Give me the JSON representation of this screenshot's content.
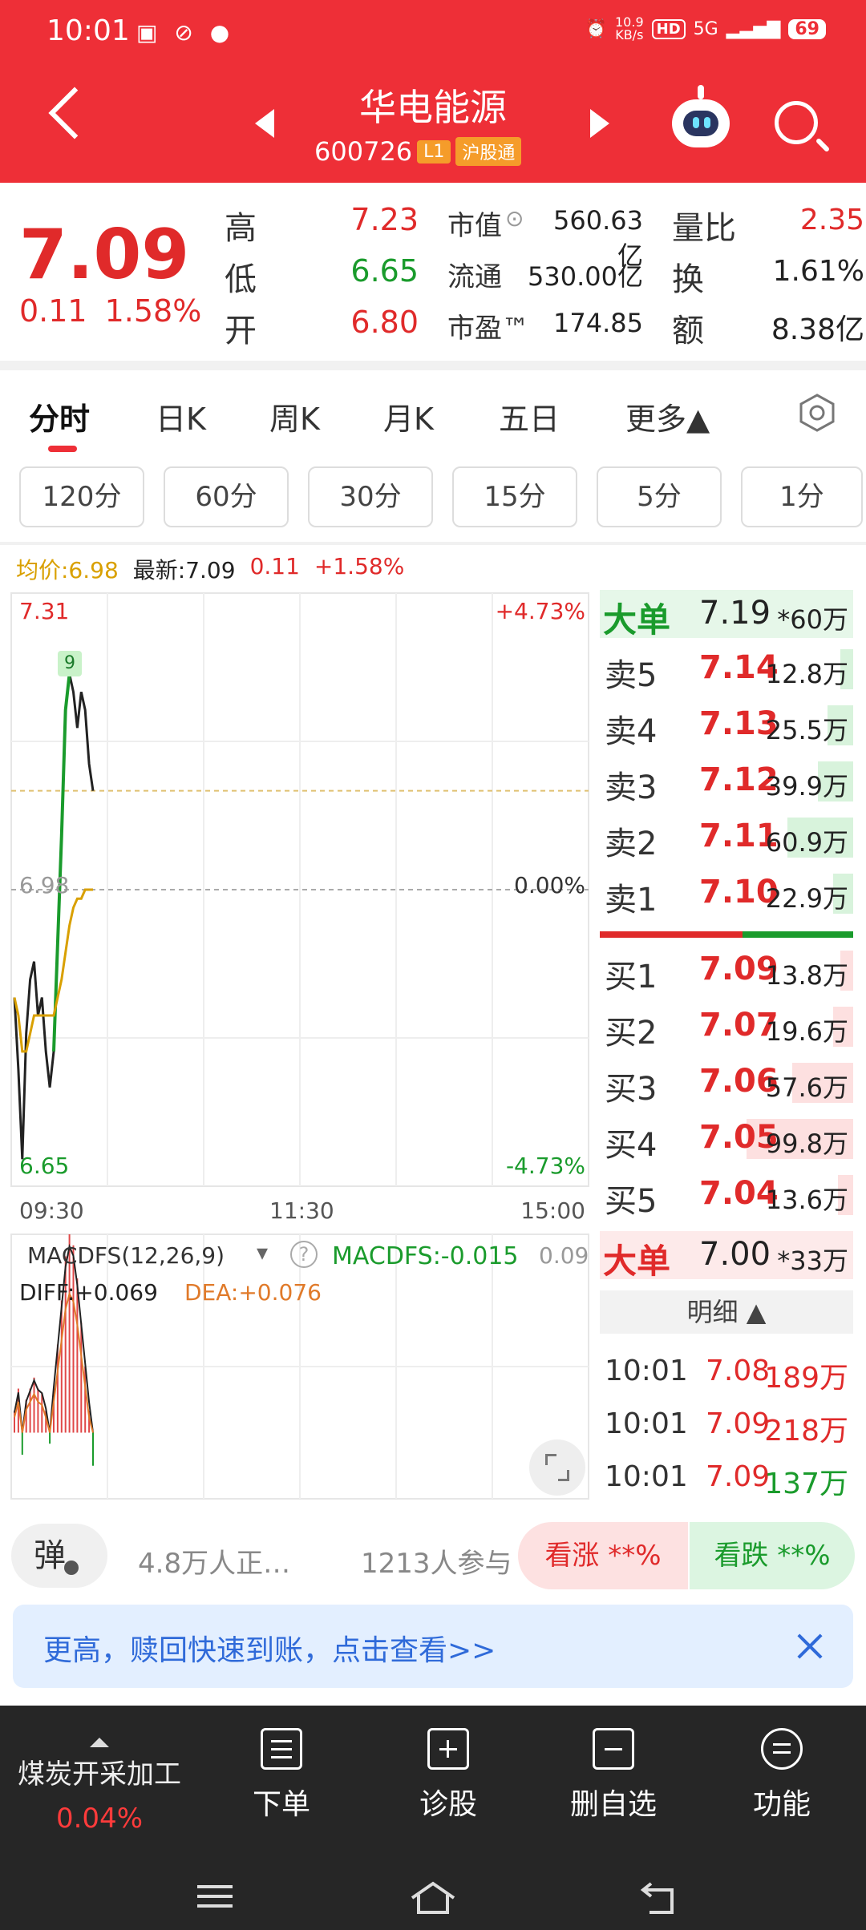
{
  "status_bar": {
    "time": "10:01",
    "notifications": "▣ ⊘ ●",
    "speed": "10.9",
    "speed_unit": "KB/s",
    "hd": "HD",
    "network": "5G",
    "battery": "69"
  },
  "header": {
    "stock_name": "华电能源",
    "stock_code": "600726",
    "tag_level": "L1",
    "tag_market": "沪股通"
  },
  "quote": {
    "price": "7.09",
    "change": "0.11",
    "change_pct": "1.58%",
    "high_label": "高",
    "high": "7.23",
    "low_label": "低",
    "low": "6.65",
    "open_label": "开",
    "open": "6.80",
    "mktcap_label": "市值",
    "mktcap": "560.63亿",
    "float_label": "流通",
    "float": "530.00亿",
    "pe_label": "市盈™",
    "pe": "174.85",
    "vol_ratio_label": "量比",
    "vol_ratio": "2.35",
    "turnover_label": "换",
    "turnover": "1.61%",
    "amount_label": "额",
    "amount": "8.38亿"
  },
  "tabs": [
    "分时",
    "日K",
    "周K",
    "月K",
    "五日",
    "更多▲"
  ],
  "intervals": [
    "120分",
    "60分",
    "30分",
    "15分",
    "5分",
    "1分"
  ],
  "info_line": {
    "avg": "均价:6.98",
    "latest": "最新:7.09",
    "chg": "0.11",
    "pct": "+1.58%"
  },
  "chart_labels": {
    "top_price": "7.31",
    "mid_price": "6.98",
    "low_price": "6.65",
    "top_pct": "+4.73%",
    "mid_pct": "0.00%",
    "low_pct": "-4.73%",
    "t_start": "09:30",
    "t_mid": "11:30",
    "t_end": "15:00",
    "high_marker": "9",
    "macd_title": "MACDFS(12,26,9)",
    "macd_value": "MACDFS:-0.015",
    "macd_axis": "0.09",
    "diff": "DIFF:+0.069",
    "dea": "DEA:+0.076"
  },
  "chart_data": {
    "type": "line",
    "title": "",
    "xlabel": "",
    "ylabel": "",
    "x_ticks": [
      "09:30",
      "11:30",
      "15:00"
    ],
    "ylim": [
      6.65,
      7.31
    ],
    "pre_close": 6.98,
    "series": [
      {
        "values": [
          6.86,
          6.78,
          6.68,
          6.82,
          6.88,
          6.9,
          6.84,
          6.86,
          6.8,
          6.76,
          6.8,
          6.92,
          7.04,
          7.18,
          7.22,
          7.2,
          7.16,
          7.2,
          7.18,
          7.12,
          7.09
        ]
      },
      {
        "values": [
          6.86,
          6.84,
          6.8,
          6.8,
          6.82,
          6.84,
          6.84,
          6.84,
          6.84,
          6.84,
          6.84,
          6.86,
          6.88,
          6.91,
          6.94,
          6.96,
          6.97,
          6.97,
          6.98,
          6.98,
          6.98
        ]
      }
    ],
    "macd_bars": [
      0.01,
      0.02,
      -0.01,
      0.015,
      0.02,
      0.025,
      0.02,
      0.018,
      0.01,
      -0.005,
      0.02,
      0.04,
      0.06,
      0.08,
      0.09,
      0.085,
      0.07,
      0.05,
      0.03,
      0.01,
      -0.015
    ],
    "macd_ylim": [
      -0.03,
      0.09
    ]
  },
  "orderbook": {
    "big_sell": {
      "label": "大单",
      "price": "7.19",
      "vol": "*60万"
    },
    "asks": [
      {
        "label": "卖5",
        "price": "7.14",
        "vol": "12.8万",
        "fill": 0.05
      },
      {
        "label": "卖4",
        "price": "7.13",
        "vol": "25.5万",
        "fill": 0.1
      },
      {
        "label": "卖3",
        "price": "7.12",
        "vol": "39.9万",
        "fill": 0.14
      },
      {
        "label": "卖2",
        "price": "7.11",
        "vol": "60.9万",
        "fill": 0.26
      },
      {
        "label": "卖1",
        "price": "7.10",
        "vol": "22.9万",
        "fill": 0.08
      }
    ],
    "bids": [
      {
        "label": "买1",
        "price": "7.09",
        "vol": "13.8万",
        "fill": 0.05
      },
      {
        "label": "买2",
        "price": "7.07",
        "vol": "19.6万",
        "fill": 0.08
      },
      {
        "label": "买3",
        "price": "7.06",
        "vol": "57.6万",
        "fill": 0.24
      },
      {
        "label": "买4",
        "price": "7.05",
        "vol": "99.8万",
        "fill": 0.42
      },
      {
        "label": "买5",
        "price": "7.04",
        "vol": "13.6万",
        "fill": 0.06
      }
    ],
    "big_buy": {
      "label": "大单",
      "price": "7.00",
      "vol": "*33万"
    },
    "detail_label": "明细 ▲",
    "trades": [
      {
        "time": "10:01",
        "price": "7.08",
        "vol": "189万"
      },
      {
        "time": "10:01",
        "price": "7.09",
        "vol": "218万"
      },
      {
        "time": "10:01",
        "price": "7.09",
        "vol": "137万"
      }
    ]
  },
  "colors": {
    "header_red": "#ee2f37",
    "up_red": "#e02a2a",
    "down_green": "#1a9b2c",
    "avg_yellow": "#d9a000"
  },
  "danmu": {
    "btn": "弹",
    "crowd": "4.8万人正…",
    "join": "1213人参与",
    "bull": "看涨 **%",
    "bear": "看跌 **%"
  },
  "banner": {
    "text": "更高，赎回快速到账，点击查看>>"
  },
  "bottom_nav": {
    "sector_name": "煤炭开采加工",
    "sector_pct": "0.04%",
    "items": [
      "下单",
      "诊股",
      "删自选",
      "功能"
    ]
  }
}
